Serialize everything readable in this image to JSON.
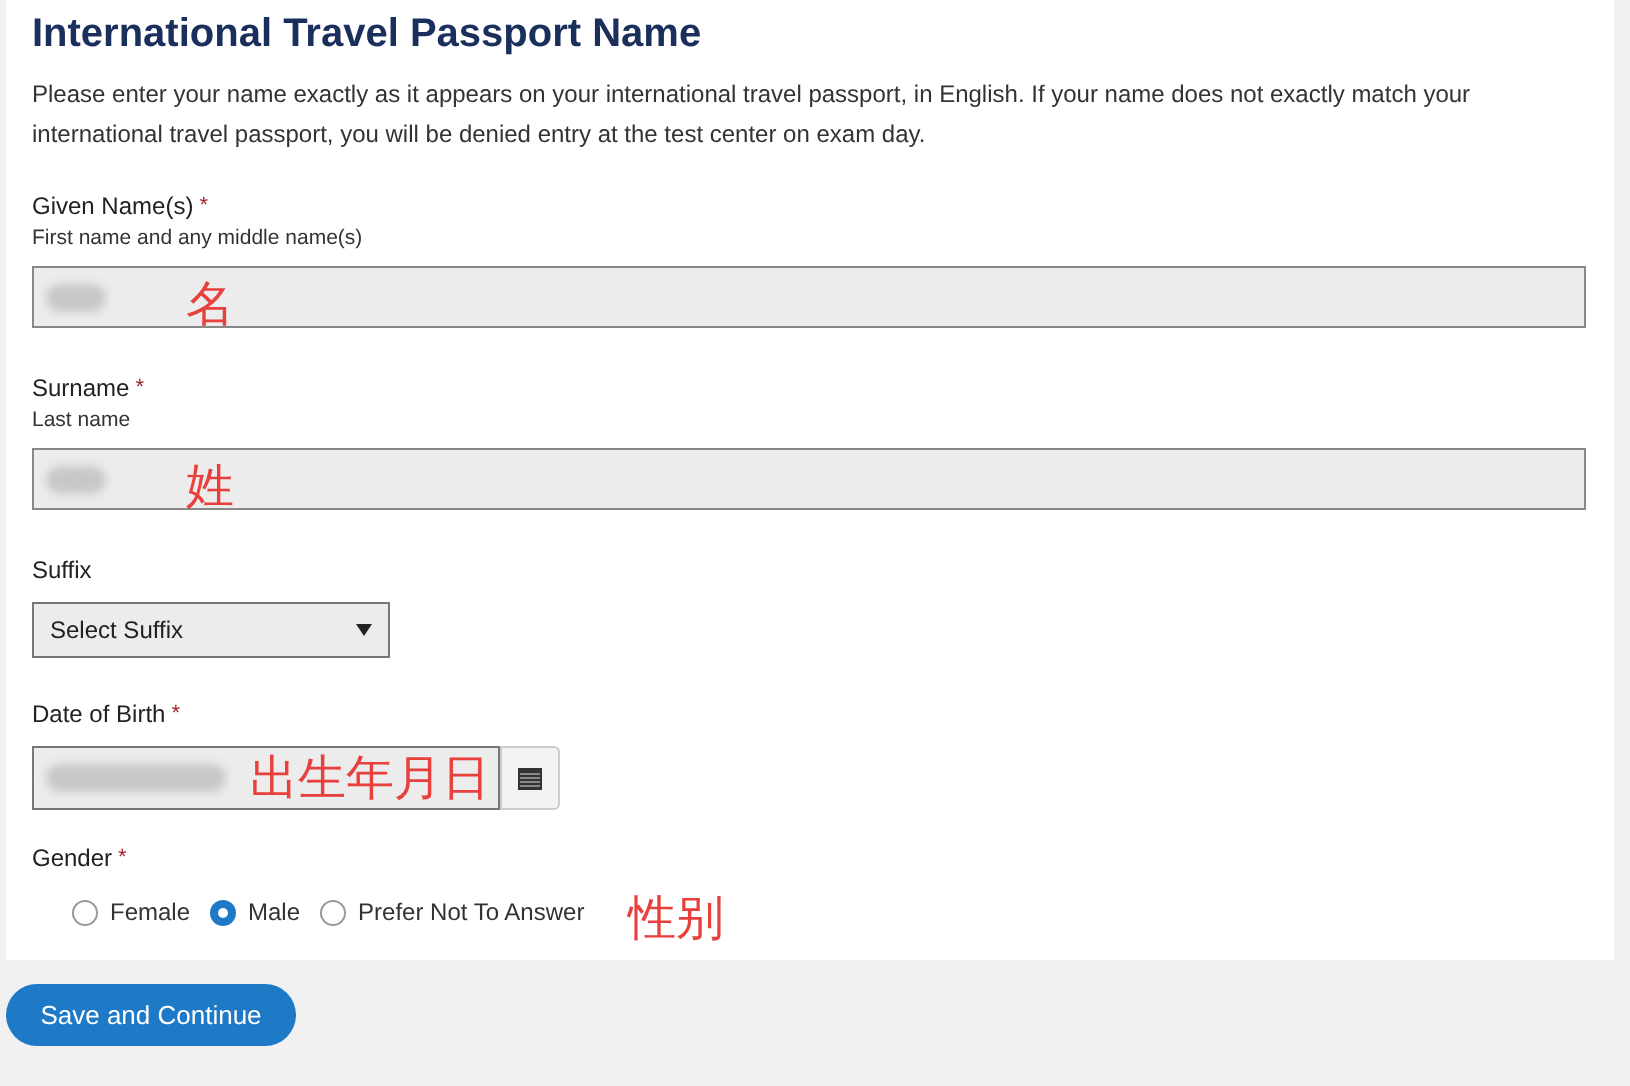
{
  "heading": "International Travel Passport Name",
  "intro": "Please enter your name exactly as it appears on your international travel passport, in English. If your name does not exactly match your international travel passport, you will be denied entry at the test center on exam day.",
  "fields": [
    {
      "kind": "text",
      "label": "Given Name(s)",
      "required_mark": "*",
      "hint": "First name and any middle name(s)",
      "annotation": "名"
    },
    {
      "kind": "text",
      "label": "Surname",
      "required_mark": "*",
      "hint": "Last name",
      "annotation": "姓"
    },
    {
      "kind": "select",
      "label": "Suffix",
      "value": "Select Suffix"
    },
    {
      "kind": "date",
      "label": "Date of Birth",
      "required_mark": "*",
      "annotation": "出生年月日"
    },
    {
      "kind": "radio",
      "label": "Gender",
      "required_mark": "*",
      "annotation": "性别",
      "options": [
        {
          "label": "Female",
          "selected": false
        },
        {
          "label": "Male",
          "selected": true
        },
        {
          "label": "Prefer Not To Answer",
          "selected": false
        }
      ]
    }
  ],
  "button": "Save and Continue"
}
